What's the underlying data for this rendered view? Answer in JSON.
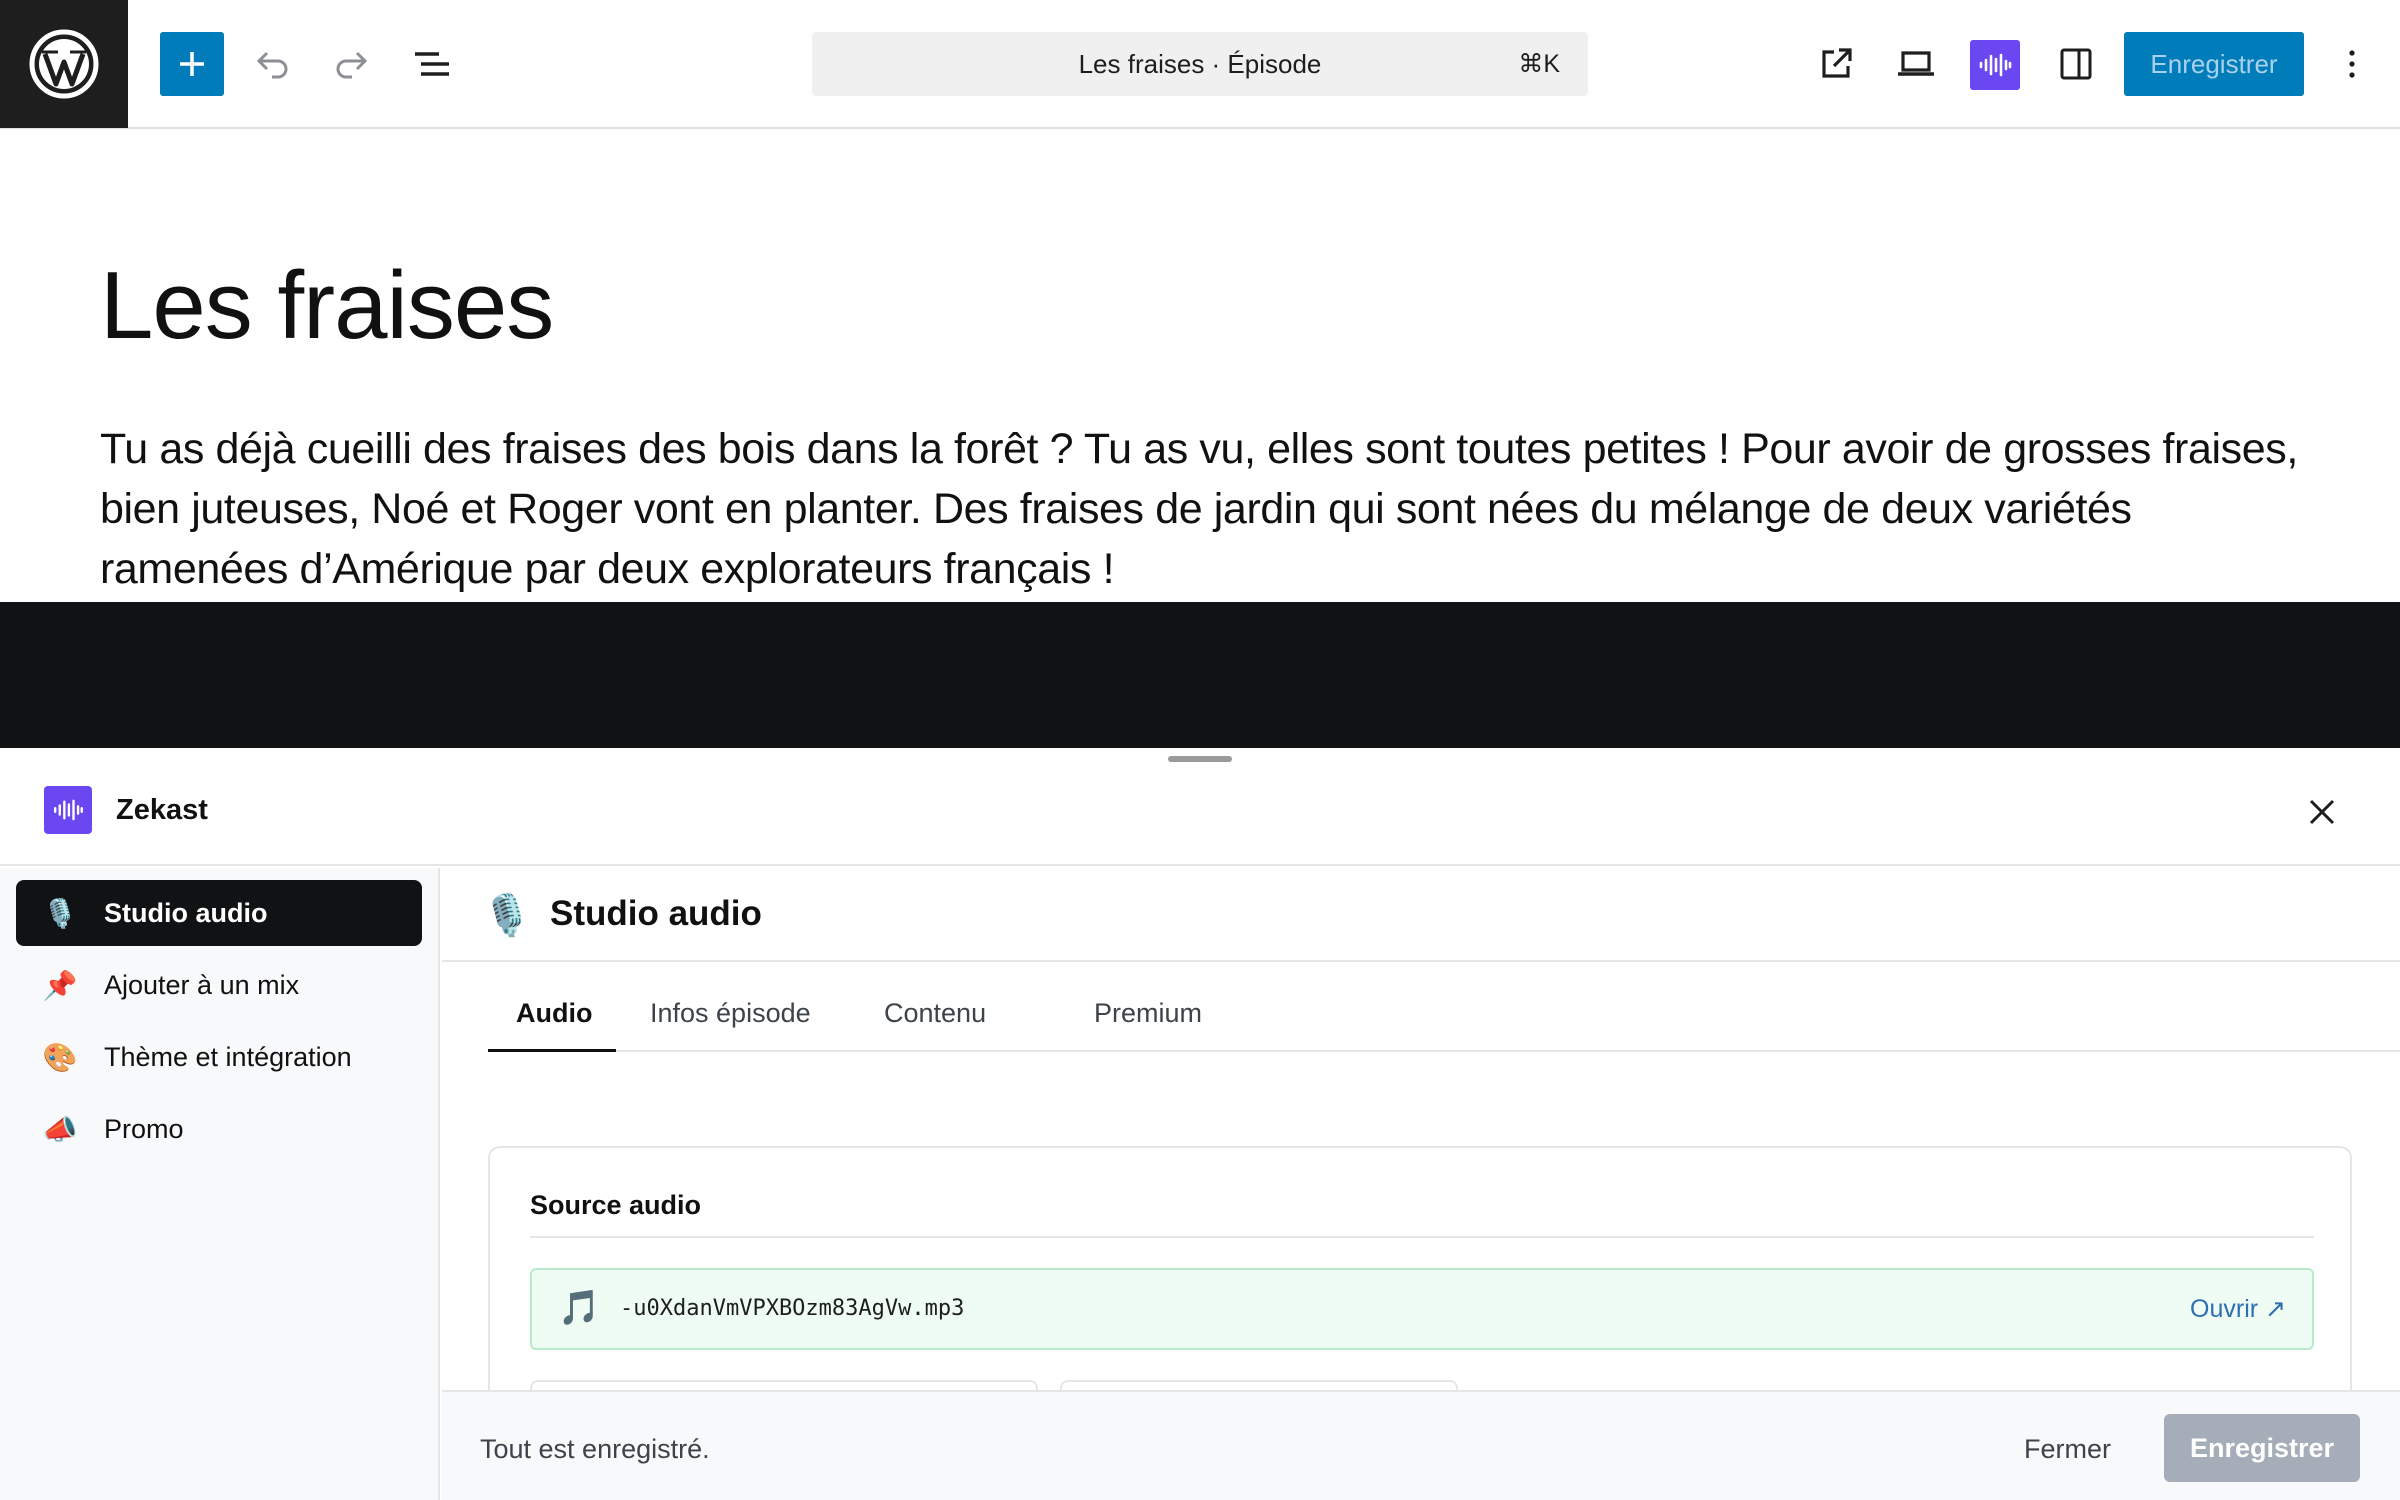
{
  "toolbar": {
    "document_title": "Les fraises · Épisode",
    "shortcut": "⌘K",
    "save_label": "Enregistrer"
  },
  "post": {
    "title": "Les fraises",
    "body": "Tu as déjà cueilli des fraises des bois dans la forêt ? Tu as vu, elles sont toutes petites ! Pour avoir de grosses fraises, bien juteuses, Noé et Roger vont en planter. Des fraises de jardin qui sont nées du mélange de deux variétés ramenées d’Amérique par deux explorateurs français !"
  },
  "panel": {
    "plugin_name": "Zekast",
    "nav": [
      {
        "label": "Studio audio",
        "icon": "microphone-icon",
        "emoji": "🎙️",
        "active": true
      },
      {
        "label": "Ajouter à un mix",
        "icon": "pin-icon",
        "emoji": "📌"
      },
      {
        "label": "Thème et intégration",
        "icon": "palette-icon",
        "emoji": "🎨"
      },
      {
        "label": "Promo",
        "icon": "megaphone-icon",
        "emoji": "📣"
      }
    ],
    "section_title": "Studio audio",
    "section_emoji": "🎙️",
    "tabs": [
      "Audio",
      "Infos épisode",
      "Contenu",
      "Premium"
    ],
    "active_tab": "Audio",
    "source": {
      "title": "Source audio",
      "emoji": "🎵",
      "file_name": "-u0XdanVmVPXBOzm83AgVw.mp3",
      "open_label": "Ouvrir ↗"
    },
    "footer": {
      "status": "Tout est enregistré.",
      "close_label": "Fermer",
      "save_label": "Enregistrer"
    }
  },
  "colors": {
    "wp_blue": "#007cba",
    "zekast_purple": "#6a47f0",
    "dark": "#111214",
    "success_bg": "#effcf4"
  }
}
